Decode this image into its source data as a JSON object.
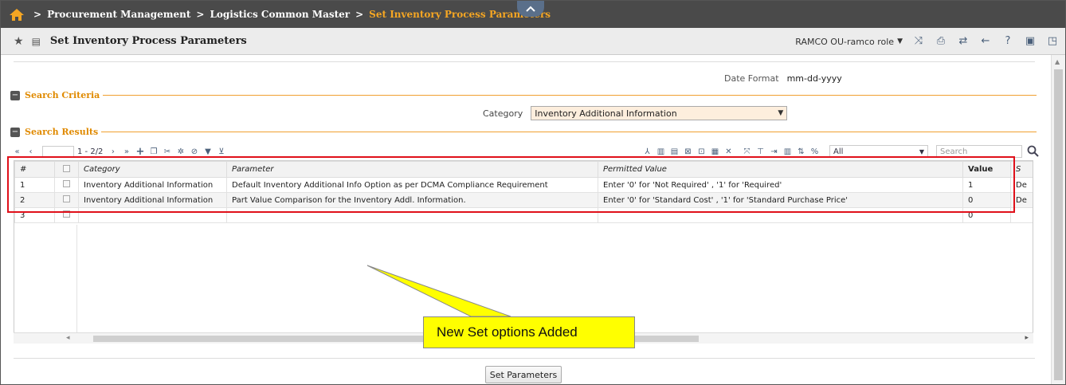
{
  "breadcrumb": {
    "items": [
      "Procurement Management",
      "Logistics Common Master"
    ],
    "current": "Set Inventory Process Parameters"
  },
  "titlebar": {
    "title": "Set Inventory Process Parameters",
    "role": "RAMCO OU-ramco role",
    "icons": [
      "shuffle-icon",
      "print-icon",
      "swap-icon",
      "back-icon",
      "help-icon",
      "settings-icon",
      "minimize-icon"
    ]
  },
  "date_format": {
    "label": "Date Format",
    "value": "mm-dd-yyyy"
  },
  "search_criteria": {
    "label": "Search Criteria",
    "category_label": "Category",
    "category_value": "Inventory Additional Information"
  },
  "search_results": {
    "label": "Search Results",
    "pager_text": "1 - 2/2",
    "filter_value": "All",
    "search_placeholder": "Search",
    "columns": [
      "#",
      "",
      "Category",
      "Parameter",
      "Permitted Value",
      "Value",
      "S"
    ],
    "rows": [
      {
        "num": "1",
        "category": "Inventory Additional Information",
        "parameter": "Default Inventory Additional Info Option as per DCMA Compliance Requirement",
        "permitted": "Enter '0' for 'Not Required' , '1' for 'Required'",
        "value": "1",
        "s": "De"
      },
      {
        "num": "2",
        "category": "Inventory Additional Information",
        "parameter": "Part Value Comparison for the Inventory Addl. Information.",
        "permitted": "Enter '0' for 'Standard Cost' , '1' for 'Standard Purchase Price'",
        "value": "0",
        "s": "De"
      },
      {
        "num": "3",
        "category": "",
        "parameter": "",
        "permitted": "",
        "value": "0",
        "s": ""
      }
    ]
  },
  "set_button": "Set Parameters",
  "callout": {
    "text": "New Set options Added",
    "color": "#ffff00"
  },
  "colors": {
    "breadcrumb_current": "#f5a623",
    "section_label": "#e08a00",
    "highlight": "#e0101a"
  }
}
